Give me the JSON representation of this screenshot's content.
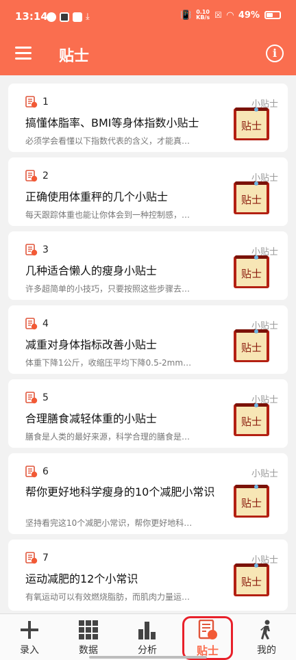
{
  "status_bar": {
    "time": "13:14",
    "net_speed_value": "0.10",
    "net_speed_unit": "KB/s",
    "battery": "49%"
  },
  "app_bar": {
    "title": "贴士",
    "menu_icon": "hamburger-menu-icon",
    "info_icon": "info-icon",
    "info_glyph": "i"
  },
  "tips": [
    {
      "number": "1",
      "category": "小贴士",
      "title": "搞懂体脂率、BMI等身体指数小贴士",
      "description": "必须学会看懂以下指数代表的含义，才能真…",
      "thumb_label": "贴士"
    },
    {
      "number": "2",
      "category": "小贴士",
      "title": "正确使用体重秤的几个小贴士",
      "description": "每天跟踪体重也能让你体会到一种控制感，…",
      "thumb_label": "贴士"
    },
    {
      "number": "3",
      "category": "小贴士",
      "title": "几种适合懒人的瘦身小贴士",
      "description": "许多超简单的小技巧，只要按照这些步骤去…",
      "thumb_label": "贴士"
    },
    {
      "number": "4",
      "category": "小贴士",
      "title": "减重对身体指标改善小贴士",
      "description": "体重下降1公斤，收缩压平均下降0.5-2mm…",
      "thumb_label": "贴士"
    },
    {
      "number": "5",
      "category": "小贴士",
      "title": "合理膳食减轻体重的小贴士",
      "description": "膳食是人类的最好来源，科学合理的膳食是…",
      "thumb_label": "贴士"
    },
    {
      "number": "6",
      "category": "小贴士",
      "title": "帮你更好地科学瘦身的10个减肥小常识",
      "description": "坚持看完这10个减肥小常识，帮你更好地科…",
      "thumb_label": "贴士"
    },
    {
      "number": "7",
      "category": "小贴士",
      "title": "运动减肥的12个小常识",
      "description": "有氧运动可以有效燃烧脂肪，而肌肉力量运…",
      "thumb_label": "贴士"
    }
  ],
  "bottom_nav": [
    {
      "label": "录入",
      "icon": "plus-icon"
    },
    {
      "label": "数据",
      "icon": "grid-icon"
    },
    {
      "label": "分析",
      "icon": "bar-chart-icon"
    },
    {
      "label": "贴士",
      "icon": "tips-document-icon",
      "active": true
    },
    {
      "label": "我的",
      "icon": "person-walking-icon"
    }
  ],
  "colors": {
    "brand": "#fa6e4f",
    "highlight_box": "#e8202a"
  }
}
